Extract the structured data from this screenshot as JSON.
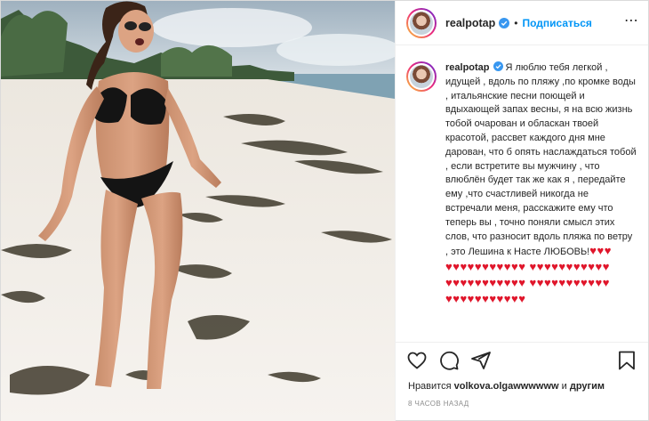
{
  "header": {
    "username": "realpotap",
    "separator": "•",
    "follow_label": "Подписаться",
    "more_glyph": "⋯"
  },
  "caption": {
    "username": "realpotap",
    "text": "Я люблю тебя легкой , идущей , вдоль по пляжу ,по кромке воды , итальянские песни поющей и вдыхающей запах весны, я на всю жизнь тобой очарован и обласкан твоей красотой, рассвет каждого дня мне дарован, что б опять наслаждаться тобой , если встретите вы мужчину , что влюблён будет так же как я , передайте ему ,что счастливей никогда не встречали меня, расскажите ему что теперь вы , точно поняли смысл этих слов, что разносит вдоль пляжа по ветру , это Лешина к Насте ЛЮБОВЬ!",
    "hearts": "♥♥♥ ♥♥♥♥♥♥♥♥♥♥♥ ♥♥♥♥♥♥♥♥♥♥♥ ♥♥♥♥♥♥♥♥♥♥♥ ♥♥♥♥♥♥♥♥♥♥♥ ♥♥♥♥♥♥♥♥♥♥♥"
  },
  "likes": {
    "prefix": "Нравится",
    "user": "volkova.olgawwwwww",
    "suffix": "и",
    "others": "другим"
  },
  "timestamp": "8 часов назад",
  "icons": {
    "verified": "verified-badge-icon",
    "like": "heart-icon",
    "comment": "comment-icon",
    "share": "share-icon",
    "save": "bookmark-icon",
    "more": "more-options-icon"
  },
  "colors": {
    "accent": "#0095f6",
    "verified": "#3897f0",
    "heart": "#e0162b",
    "muted": "#8e8e8e"
  }
}
